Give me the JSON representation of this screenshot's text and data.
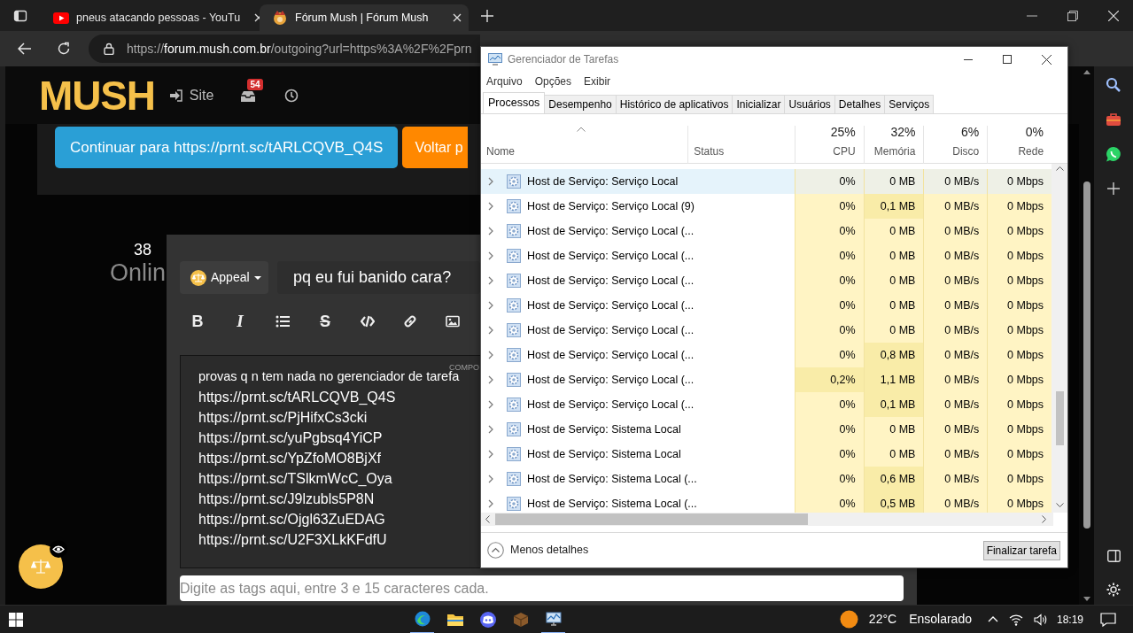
{
  "browser": {
    "tabs": [
      {
        "title": "pneus atacando pessoas - YouTu",
        "selected": false,
        "kind": "video"
      },
      {
        "title": "Fórum Mush | Fórum Mush",
        "selected": true,
        "kind": "forum"
      }
    ],
    "address": {
      "scheme": "https://",
      "host": "forum.mush.com.br",
      "path": "/outgoing?url=https%3A%2F%2Fprn"
    }
  },
  "site": {
    "logo": "MUSH",
    "nav_site": "Site",
    "inbox_badge": "54",
    "continue_button": "Continuar para https://prnt.sc/tARLCQVB_Q4S",
    "back_button": "Voltar p",
    "online_count": "38",
    "online_label": "Onlin"
  },
  "editor": {
    "prefix": "Appeal",
    "title": "pq eu fui banido cara?",
    "mode_label": "COMPO",
    "toolbar": [
      {
        "kind": "bold",
        "label": "B"
      },
      {
        "kind": "italic",
        "label": "I"
      },
      {
        "kind": "list"
      },
      {
        "kind": "strike",
        "label": "S"
      },
      {
        "kind": "code"
      },
      {
        "kind": "link"
      },
      {
        "kind": "image"
      }
    ],
    "body_lines": [
      "provas q n tem nada no gerenciador de tarefa",
      "https://prnt.sc/tARLCQVB_Q4S",
      "https://prnt.sc/PjHifxCs3cki",
      "https://prnt.sc/yuPgbsq4YiCP",
      "https://prnt.sc/YpZfoMO8BjXf",
      "https://prnt.sc/TSlkmWcC_Oya",
      "https://prnt.sc/J9lzubls5P8N",
      "https://prnt.sc/Ojgl63ZuEDAG",
      "https://prnt.sc/U2F3XLkKFdfU"
    ],
    "tags_placeholder": "Digite as tags aqui, entre 3 e 15 caracteres cada."
  },
  "task_manager": {
    "title": "Gerenciador de Tarefas",
    "menu": [
      "Arquivo",
      "Opções",
      "Exibir"
    ],
    "tabs": [
      {
        "label": "Processos",
        "selected": true
      },
      {
        "label": "Desempenho",
        "selected": false
      },
      {
        "label": "Histórico de aplicativos",
        "selected": false
      },
      {
        "label": "Inicializar",
        "selected": false
      },
      {
        "label": "Usuários",
        "selected": false
      },
      {
        "label": "Detalhes",
        "selected": false
      },
      {
        "label": "Serviços",
        "selected": false
      }
    ],
    "name_column": "Nome",
    "status_column": "Status",
    "columns": [
      {
        "usage": "25%",
        "label": "CPU"
      },
      {
        "usage": "32%",
        "label": "Memória"
      },
      {
        "usage": "6%",
        "label": "Disco"
      },
      {
        "usage": "0%",
        "label": "Rede"
      }
    ],
    "rows": [
      {
        "name": "Host de Serviço: Serviço Local",
        "selected": true,
        "cells": [
          {
            "text": "0%",
            "color": "#eef0e6"
          },
          {
            "text": "0 MB",
            "color": "#eef0e6"
          },
          {
            "text": "0 MB/s",
            "color": "#eef0e6"
          },
          {
            "text": "0 Mbps",
            "color": "#eef0e6"
          }
        ]
      },
      {
        "name": "Host de Serviço: Serviço Local (9)",
        "selected": false,
        "cells": [
          {
            "text": "0%",
            "color": "#fff4c4"
          },
          {
            "text": "0,1 MB",
            "color": "#f9eca8"
          },
          {
            "text": "0 MB/s",
            "color": "#fff4c4"
          },
          {
            "text": "0 Mbps",
            "color": "#fff4c4"
          }
        ]
      },
      {
        "name": "Host de Serviço: Serviço Local (...",
        "selected": false,
        "cells": [
          {
            "text": "0%",
            "color": "#fff4c4"
          },
          {
            "text": "0 MB",
            "color": "#fff4c4"
          },
          {
            "text": "0 MB/s",
            "color": "#fff4c4"
          },
          {
            "text": "0 Mbps",
            "color": "#fff4c4"
          }
        ]
      },
      {
        "name": "Host de Serviço: Serviço Local (...",
        "selected": false,
        "cells": [
          {
            "text": "0%",
            "color": "#fff4c4"
          },
          {
            "text": "0 MB",
            "color": "#fff4c4"
          },
          {
            "text": "0 MB/s",
            "color": "#fff4c4"
          },
          {
            "text": "0 Mbps",
            "color": "#fff4c4"
          }
        ]
      },
      {
        "name": "Host de Serviço: Serviço Local (...",
        "selected": false,
        "cells": [
          {
            "text": "0%",
            "color": "#fff4c4"
          },
          {
            "text": "0 MB",
            "color": "#fff4c4"
          },
          {
            "text": "0 MB/s",
            "color": "#fff4c4"
          },
          {
            "text": "0 Mbps",
            "color": "#fff4c4"
          }
        ]
      },
      {
        "name": "Host de Serviço: Serviço Local (...",
        "selected": false,
        "cells": [
          {
            "text": "0%",
            "color": "#fff4c4"
          },
          {
            "text": "0 MB",
            "color": "#fff4c4"
          },
          {
            "text": "0 MB/s",
            "color": "#fff4c4"
          },
          {
            "text": "0 Mbps",
            "color": "#fff4c4"
          }
        ]
      },
      {
        "name": "Host de Serviço: Serviço Local (...",
        "selected": false,
        "cells": [
          {
            "text": "0%",
            "color": "#fff4c4"
          },
          {
            "text": "0 MB",
            "color": "#fff4c4"
          },
          {
            "text": "0 MB/s",
            "color": "#fff4c4"
          },
          {
            "text": "0 Mbps",
            "color": "#fff4c4"
          }
        ]
      },
      {
        "name": "Host de Serviço: Serviço Local (...",
        "selected": false,
        "cells": [
          {
            "text": "0%",
            "color": "#fff4c4"
          },
          {
            "text": "0,8 MB",
            "color": "#f9eca8"
          },
          {
            "text": "0 MB/s",
            "color": "#fff4c4"
          },
          {
            "text": "0 Mbps",
            "color": "#fff4c4"
          }
        ]
      },
      {
        "name": "Host de Serviço: Serviço Local (...",
        "selected": false,
        "cells": [
          {
            "text": "0,2%",
            "color": "#f9eca8"
          },
          {
            "text": "1,1 MB",
            "color": "#f9eca8"
          },
          {
            "text": "0 MB/s",
            "color": "#fff4c4"
          },
          {
            "text": "0 Mbps",
            "color": "#fff4c4"
          }
        ]
      },
      {
        "name": "Host de Serviço: Serviço Local (...",
        "selected": false,
        "cells": [
          {
            "text": "0%",
            "color": "#fff4c4"
          },
          {
            "text": "0,1 MB",
            "color": "#f9eca8"
          },
          {
            "text": "0 MB/s",
            "color": "#fff4c4"
          },
          {
            "text": "0 Mbps",
            "color": "#fff4c4"
          }
        ]
      },
      {
        "name": "Host de Serviço: Sistema Local",
        "selected": false,
        "cells": [
          {
            "text": "0%",
            "color": "#fff4c4"
          },
          {
            "text": "0 MB",
            "color": "#fff4c4"
          },
          {
            "text": "0 MB/s",
            "color": "#fff4c4"
          },
          {
            "text": "0 Mbps",
            "color": "#fff4c4"
          }
        ]
      },
      {
        "name": "Host de Serviço: Sistema Local",
        "selected": false,
        "cells": [
          {
            "text": "0%",
            "color": "#fff4c4"
          },
          {
            "text": "0 MB",
            "color": "#fff4c4"
          },
          {
            "text": "0 MB/s",
            "color": "#fff4c4"
          },
          {
            "text": "0 Mbps",
            "color": "#fff4c4"
          }
        ]
      },
      {
        "name": "Host de Serviço: Sistema Local (...",
        "selected": false,
        "cells": [
          {
            "text": "0%",
            "color": "#fff4c4"
          },
          {
            "text": "0,6 MB",
            "color": "#f9eca8"
          },
          {
            "text": "0 MB/s",
            "color": "#fff4c4"
          },
          {
            "text": "0 Mbps",
            "color": "#fff4c4"
          }
        ]
      },
      {
        "name": "Host de Serviço: Sistema Local (...",
        "selected": false,
        "cells": [
          {
            "text": "0%",
            "color": "#fff4c4"
          },
          {
            "text": "0,5 MB",
            "color": "#f9eca8"
          },
          {
            "text": "0 MB/s",
            "color": "#fff4c4"
          },
          {
            "text": "0 Mbps",
            "color": "#fff4c4"
          }
        ]
      }
    ],
    "less_details": "Menos detalhes",
    "end_task": "Finalizar tarefa"
  },
  "taskbar": {
    "weather_temp": "22°C",
    "weather_text": "Ensolarado",
    "time": "18:19"
  }
}
